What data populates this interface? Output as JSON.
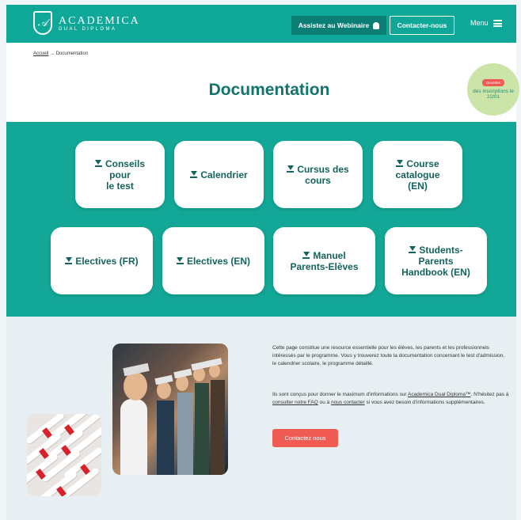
{
  "header": {
    "logo_title": "ACADEMICA",
    "logo_subtitle": "DUAL DIPLOMA",
    "webinar_label": "Assistez au Webinaire",
    "contact_label": "Contacter-nous",
    "menu_label": "Menu"
  },
  "breadcrumb": {
    "home": "Accueil",
    "separator": "→",
    "current": "Documentation"
  },
  "page_title": "Documentation",
  "badge": {
    "pill": "Ouvertes",
    "text": "des inscriptions le 22/01"
  },
  "docs": [
    {
      "label_line1": "Conseils",
      "label_line2": "pour",
      "label_line3": "le test"
    },
    {
      "label_line1": "Calendrier",
      "label_line2": "",
      "label_line3": ""
    },
    {
      "label_line1": "Cursus des",
      "label_line2": "cours",
      "label_line3": ""
    },
    {
      "label_line1": "Course",
      "label_line2": "catalogue",
      "label_line3": "(EN)"
    },
    {
      "label_line1": "Electives (FR)",
      "label_line2": "",
      "label_line3": ""
    },
    {
      "label_line1": "Electives (EN)",
      "label_line2": "",
      "label_line3": ""
    },
    {
      "label_line1": "Manuel",
      "label_line2": "Parents-Elèves",
      "label_line3": ""
    },
    {
      "label_line1": "Students-",
      "label_line2": "Parents",
      "label_line3": "Handbook (EN)"
    }
  ],
  "info": {
    "para1": "Cette page constitue une resource essentielle pour les élèves, les parents et les professionnels intéressés par le programme. Vous y trouverez toute la documentation concernant le test d'admission, le calendrier scolaire, le programme détaillé.",
    "para2_start": "Ils sont conçus pour donner le maximum d'informations sur ",
    "para2_link1": "Academica Dual Diploma™",
    "para2_mid": ". N'hésitez pas à ",
    "para2_link2": "consulter notre FAQ",
    "para2_mid2": " ou à ",
    "para2_link3": "nous contacter",
    "para2_end": " si vous avez besoin d'informations supplémentaires.",
    "button_label": "Contactez nous"
  },
  "colors": {
    "teal": "#12a797",
    "dark_teal": "#12756d",
    "coral": "#ef5b53",
    "light_bg": "#e8eff2"
  }
}
